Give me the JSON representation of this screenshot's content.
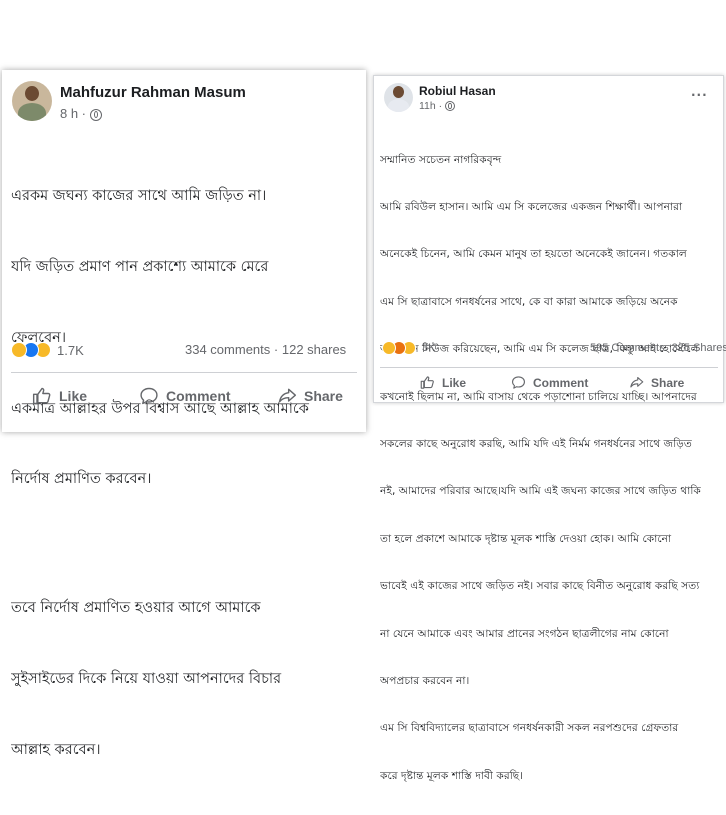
{
  "posts": [
    {
      "author": "Mahfuzur Rahman Masum",
      "time": "8 h ·",
      "more": "···",
      "lines": [
        "এরকম জঘন্য কাজের সাথে আমি জড়িত না।",
        "যদি জড়িত প্রমাণ পান প্রকাশ্যে আমাকে মেরে",
        "ফেলবেন।",
        "একমাত্র আল্লাহর উপর বিশ্বাস আছে আল্লাহ আমাকে",
        "নির্দোষ প্রমাণিত করবেন।",
        "",
        "তবে নির্দোষ প্রমাণিত হওয়ার আগে আমাকে",
        "সুইসাইডের দিকে নিয়ে যাওয়া আপনাদের বিচার",
        "আল্লাহ করবেন।"
      ],
      "reaction_count": "1.7K",
      "comments": "334 comments",
      "shares": "122 shares",
      "stats_sep": "·",
      "actions": {
        "like": "Like",
        "comment": "Comment",
        "share": "Share"
      }
    },
    {
      "author": "Robiul Hasan",
      "time": "11h ·",
      "more": "···",
      "lines": [
        "সম্মানিত সচেতন নাগরিকবৃন্দ",
        "আমি রবিউল হাসান। আমি এম সি কলেজের একজন শিক্ষার্থী। আপনারা",
        "অনেকেই চিনেন, আমি কেমন মানুষ তা হয়তো অনেকেই জানেন। গতকাল",
        "এম সি ছাত্রাবাসে গনধর্ষনের সাথে, কে বা কারা আমাকে জড়িয়ে অনেক",
        "অনলাইন নিউজ করিয়েছেন, আমি এম সি কলেজ ছাত্র, কিন্তু আই হোস্টেলে",
        "কখনোই ছিলাম না, আমি বাসায় থেকে পড়াশোনা চালিয়ে যাচ্ছি। আপনাদের",
        "সকলের কাছে অনুরোধ করছি, আমি যদি এই নির্মম গনধর্ষনের সাথে জড়িত",
        "নই, আমাদের পরিবার আছে।যদি আমি এই জঘন্য কাজের সাথে জড়িত থাকি",
        "তা হলে প্রকাশে আমাকে দৃষ্টান্ত মূলক শাস্তি দেওয়া হোক। আমি কোনো",
        "ভাবেই এই কাজের সাথে জড়িত নই। সবার কাছে বিনীত অনুরোধ করছি সত্য",
        "না যেনে আমাকে এবং আমার প্রানের সংগঠন ছাত্রলীগের নাম কোনো",
        "অপপ্রচার করবেন না।",
        "এম সি বিশ্ববিদ্যালের ছাত্রাবাসে গনধর্ষনকারী সকল নরপশুদের গ্রেফতার",
        "করে দৃষ্টান্ত মূলক শাস্তি দাবী করছি।"
      ],
      "reaction_count": "3K",
      "comments": "595 Comments",
      "shares": "325 Shares",
      "actions": {
        "like": "Like",
        "comment": "Comment",
        "share": "Share"
      }
    }
  ],
  "icons": {
    "globe": "globe-icon",
    "like": "thumbs-up-icon",
    "comment": "speech-bubble-icon",
    "share": "share-arrow-icon",
    "reactions_left": [
      "haha-reaction",
      "like-reaction",
      "sad-reaction"
    ],
    "reactions_right": [
      "haha-reaction",
      "angry-reaction",
      "sad-reaction"
    ]
  },
  "colors": {
    "like_blue": "#1877f2",
    "emoji_yellow": "#f7b928",
    "secondary_text": "#65676b"
  }
}
